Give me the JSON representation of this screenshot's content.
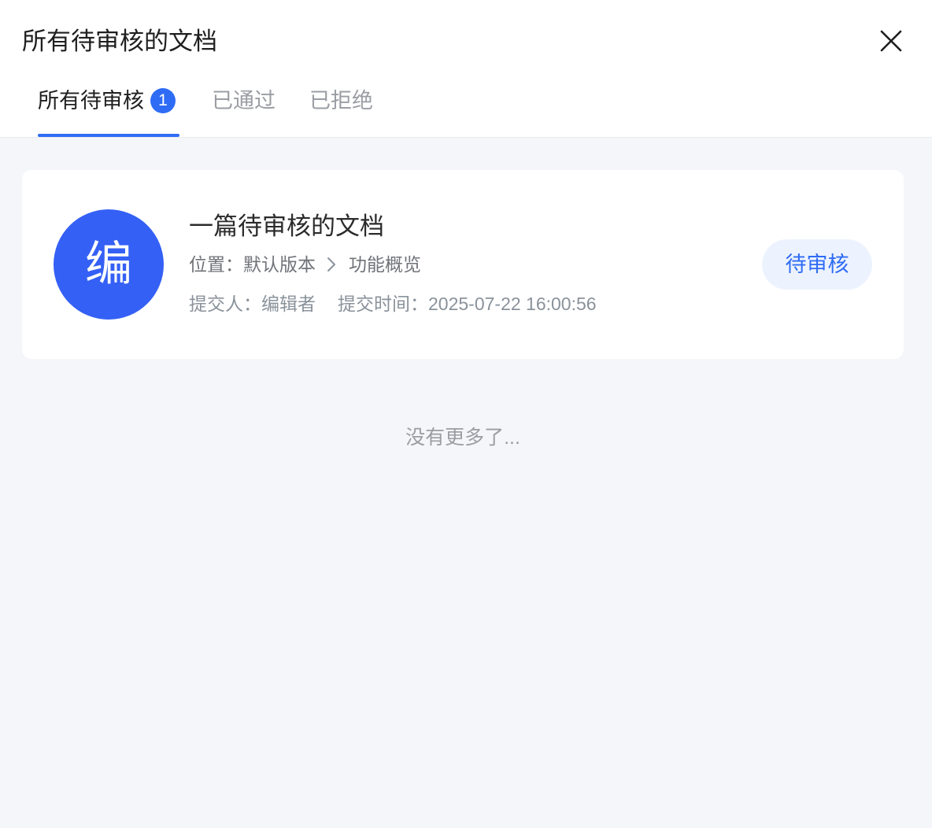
{
  "dialog": {
    "title": "所有待审核的文档"
  },
  "tabs": [
    {
      "label": "所有待审核",
      "badge": "1",
      "active": true
    },
    {
      "label": "已通过",
      "active": false
    },
    {
      "label": "已拒绝",
      "active": false
    }
  ],
  "items": [
    {
      "avatar_char": "编",
      "title": "一篇待审核的文档",
      "location_prefix": "位置：",
      "location_parent": "默认版本",
      "location_child": "功能概览",
      "submitter_label": "提交人：",
      "submitter": "编辑者",
      "submit_time_label": "提交时间：",
      "submit_time": "2025-07-22 16:00:56",
      "status": "待审核"
    }
  ],
  "footer_text": "没有更多了...",
  "colors": {
    "accent": "#2f6cf6",
    "avatar_bg": "#3460f5",
    "status_bg": "#edf3fe",
    "page_bg": "#f4f6f9"
  },
  "icons": {
    "close": "close-icon",
    "breadcrumb_separator": "chevron-right-icon"
  }
}
